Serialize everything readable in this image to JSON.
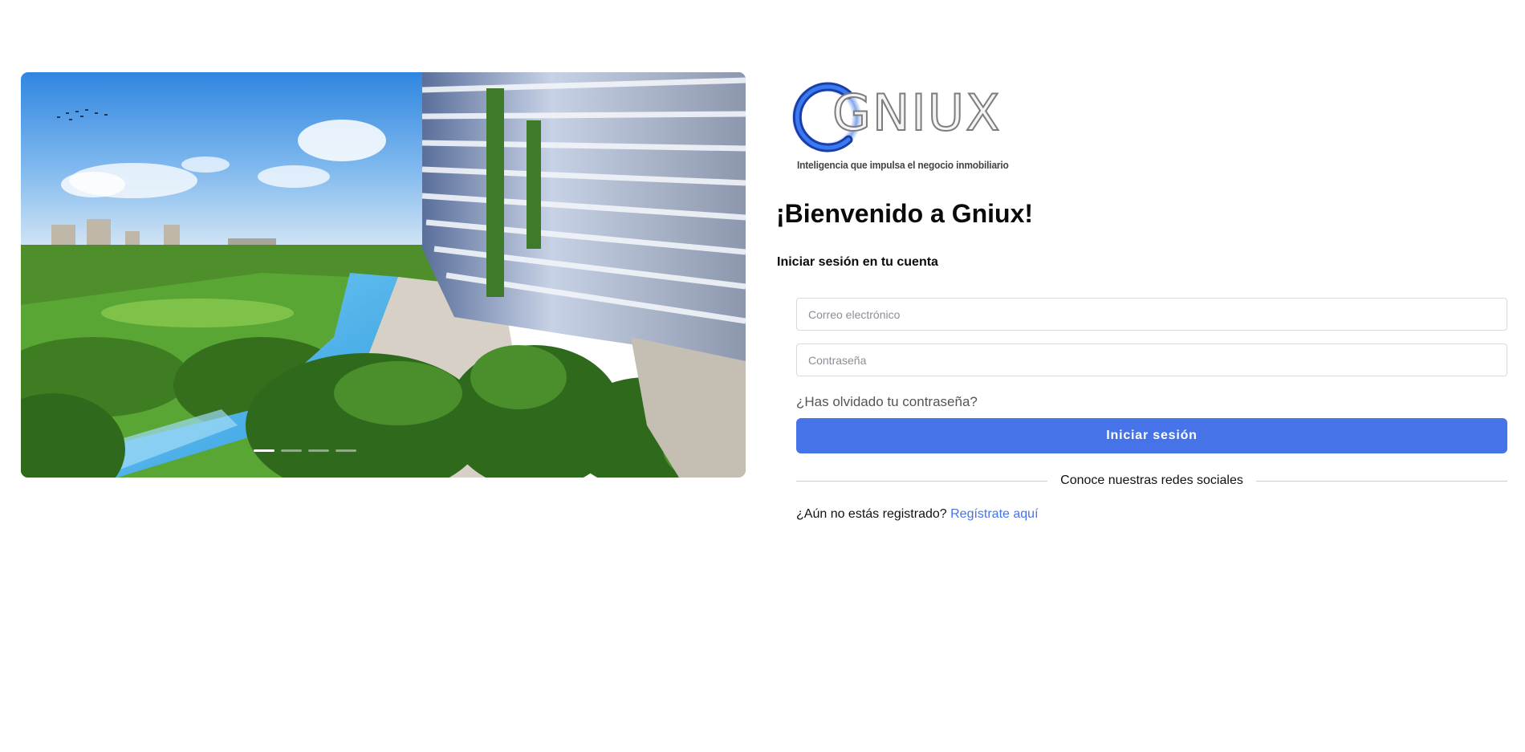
{
  "hero": {
    "carousel_indicators": [
      {
        "active": true
      },
      {
        "active": false
      },
      {
        "active": false
      },
      {
        "active": false
      }
    ]
  },
  "logo": {
    "wordmark": "GNIUX",
    "tagline": "Inteligencia que impulsa el negocio inmobiliario"
  },
  "login": {
    "welcome_title": "¡Bienvenido a Gniux!",
    "subtitle": "Iniciar sesión en tu cuenta",
    "email_placeholder": "Correo electrónico",
    "email_value": "",
    "password_placeholder": "Contraseña",
    "password_value": "",
    "forgot_password": "¿Has olvidado tu contraseña?",
    "submit_label": "Iniciar sesión",
    "social_divider": "Conoce nuestras redes sociales",
    "register_prompt": "¿Aún no estás registrado?",
    "register_link": "Regístrate aquí"
  },
  "colors": {
    "primary": "#4673e8",
    "link": "#4673e8",
    "border": "#d6d9dd",
    "logo_ring": "#1f5fd8"
  }
}
